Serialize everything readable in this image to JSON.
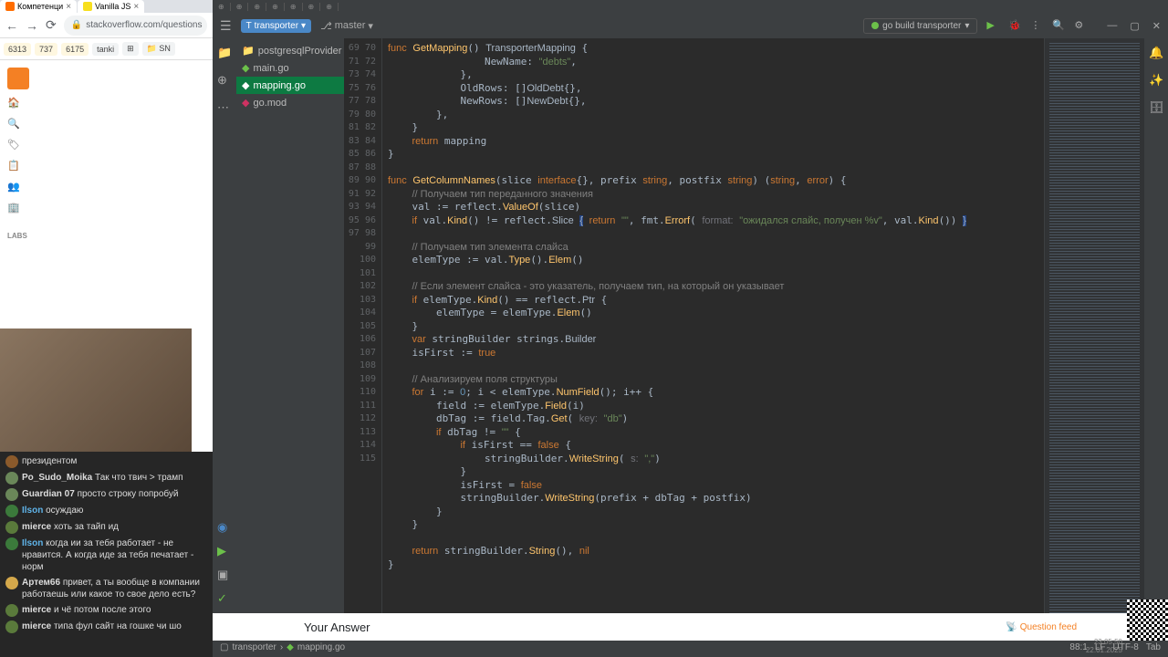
{
  "browser": {
    "tabs": [
      {
        "title": "Компетенци",
        "icon": "#ff6d00"
      },
      {
        "title": "Vanilla JS",
        "icon": "#f7df1e"
      }
    ],
    "nav": {
      "back": "←",
      "fwd": "→",
      "reload": "⟳"
    },
    "url": "stackoverflow.com/questions",
    "bookmarks": [
      {
        "label": "6313",
        "cls": "y"
      },
      {
        "label": "737",
        "cls": "y"
      },
      {
        "label": "6175",
        "cls": "y"
      },
      {
        "label": "tanki",
        "cls": ""
      },
      {
        "label": "⊞",
        "cls": ""
      },
      {
        "label": "📁 SN",
        "cls": ""
      }
    ]
  },
  "so_sidebar": {
    "items": [
      "🏠",
      "🔍",
      "🏷",
      "📋",
      "👥",
      "🏢"
    ],
    "labs": "LABS"
  },
  "chat": [
    {
      "color": "#8b5a2b",
      "user": "",
      "text": "президентом"
    },
    {
      "color": "#6a8759",
      "user": "Po_Sudo_Moika",
      "text": "Так что твич > трамп"
    },
    {
      "color": "#6a8759",
      "user": "Guardian 07",
      "text": "просто строку попробуй"
    },
    {
      "color": "#3b7a3b",
      "user": "Ilson",
      "text": "осуждаю"
    },
    {
      "color": "#5a7a3b",
      "user": "mierce",
      "text": "хоть за тайп ид"
    },
    {
      "color": "#3b7a3b",
      "user": "Ilson",
      "text": "когда ии за тебя работает - не нравится. А когда иде за тебя печатает - норм"
    },
    {
      "color": "#d4a84b",
      "user": "Артем66",
      "text": "привет, а ты вообще в компании работаешь или какое то свое дело есть?"
    },
    {
      "color": "#5a7a3b",
      "user": "mierce",
      "text": "и чё потом после этого"
    },
    {
      "color": "#5a7a3b",
      "user": "mierce",
      "text": "типа фул сайт на гошке чи шо"
    }
  ],
  "ide": {
    "project": "transporter",
    "branch": "master",
    "run_config": "go build transporter",
    "tree": [
      {
        "name": "postgresqlProvider",
        "icon": "📁",
        "sel": false
      },
      {
        "name": "main.go",
        "icon": "go",
        "sel": false
      },
      {
        "name": "mapping.go",
        "icon": "go",
        "sel": true
      },
      {
        "name": "go.mod",
        "icon": "go",
        "sel": false
      }
    ],
    "breadcrumb": [
      "transporter",
      "mapping.go"
    ],
    "status": {
      "pos": "88:1",
      "lf": "LF",
      "enc": "UTF-8",
      "indent": "Tab"
    },
    "lines_start": 69,
    "lines_end": 115
  },
  "answer": {
    "label": "Your Answer",
    "feed": "Question feed"
  },
  "timestamp": {
    "time": "23:05:50",
    "date": "22.01.2025"
  }
}
